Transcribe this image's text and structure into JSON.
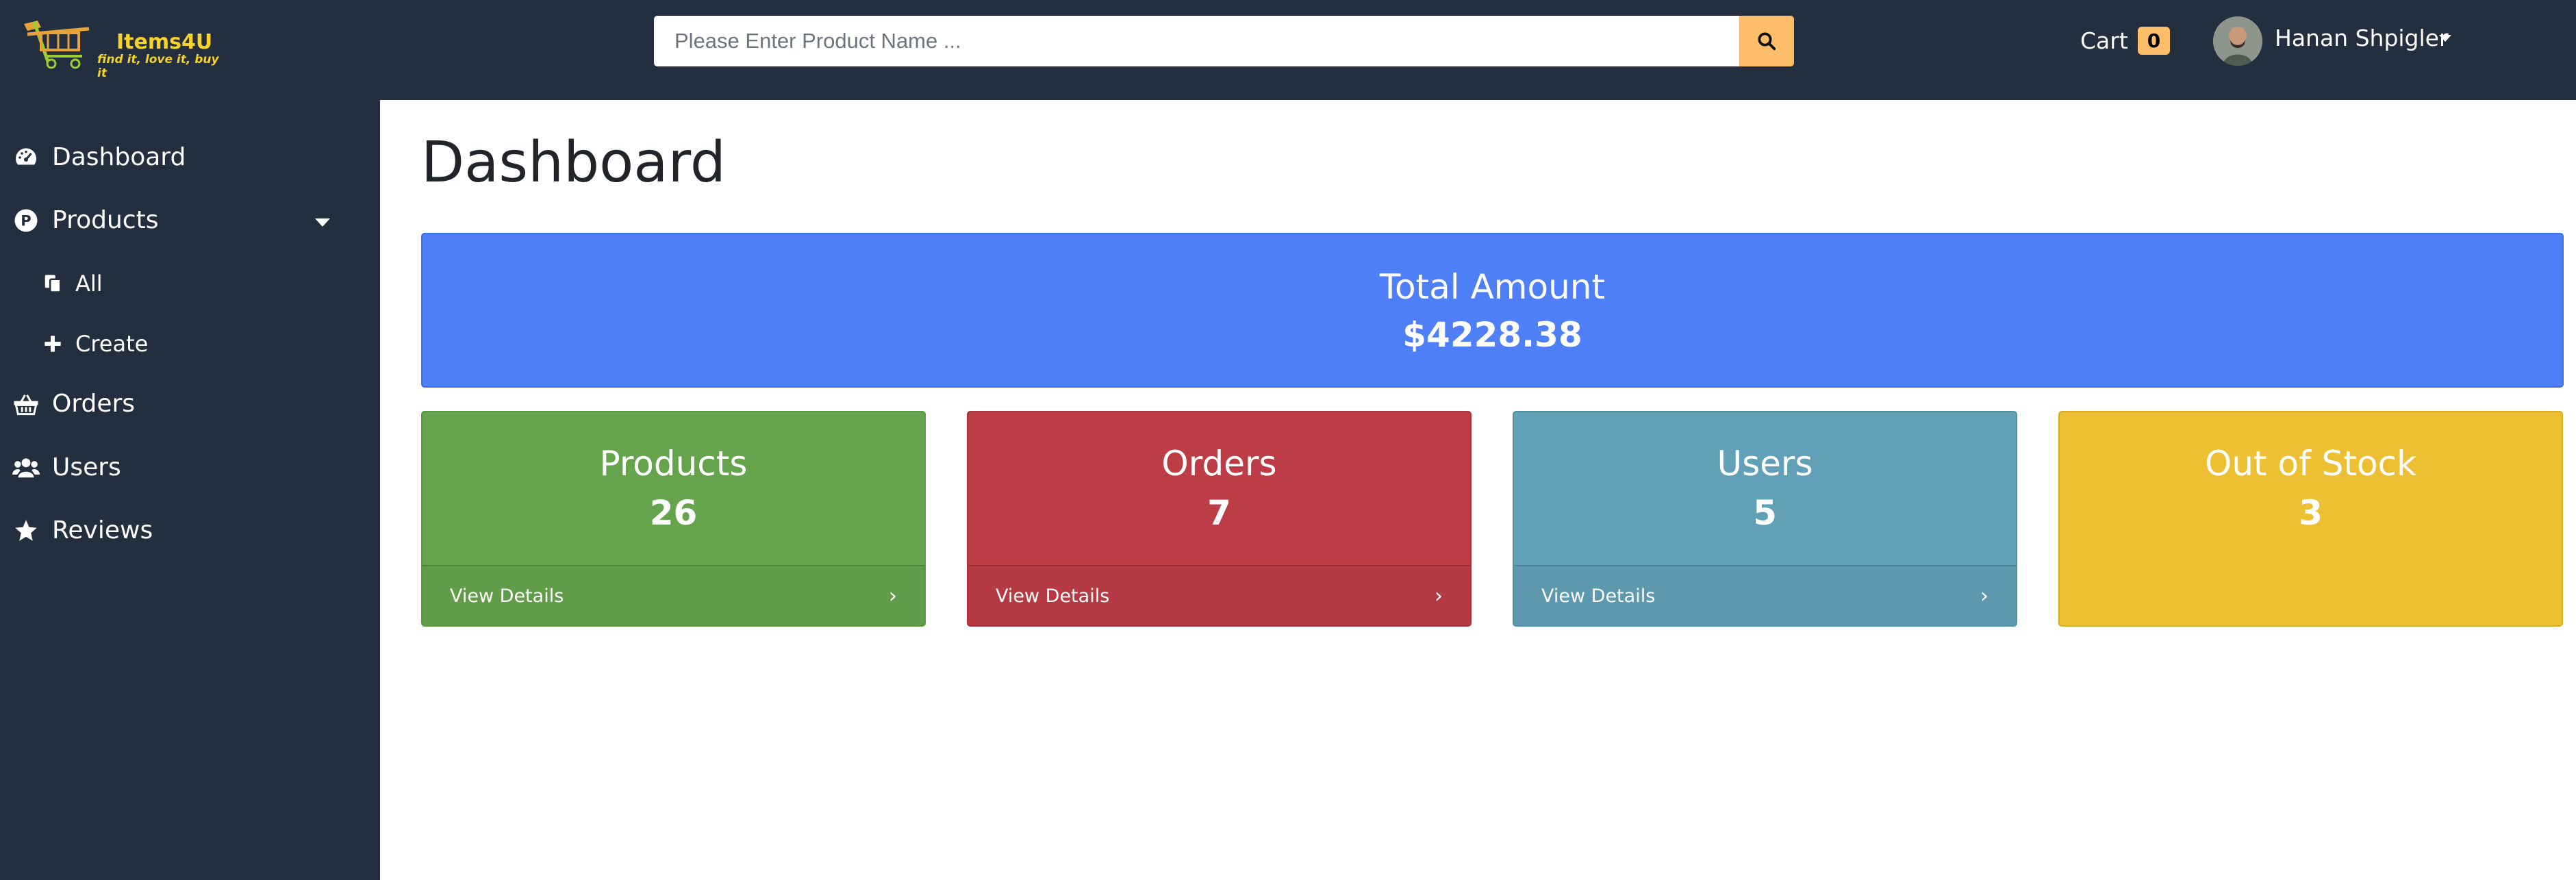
{
  "header": {
    "logo_text": "Items4U",
    "logo_tagline": "find it, love it, buy it",
    "search_placeholder": "Please Enter Product Name ...",
    "cart_label": "Cart",
    "cart_count": "0",
    "user_name": "Hanan Shpigler"
  },
  "sidebar": {
    "items": [
      {
        "label": "Dashboard",
        "icon": "tachometer-icon"
      },
      {
        "label": "Products",
        "icon": "product-p-icon"
      },
      {
        "label": "All",
        "icon": "copy-icon"
      },
      {
        "label": "Create",
        "icon": "plus-icon"
      },
      {
        "label": "Orders",
        "icon": "basket-icon"
      },
      {
        "label": "Users",
        "icon": "users-icon"
      },
      {
        "label": "Reviews",
        "icon": "star-icon"
      }
    ]
  },
  "main": {
    "title": "Dashboard",
    "total": {
      "label": "Total Amount",
      "value": "$4228.38"
    },
    "cards": [
      {
        "label": "Products",
        "value": "26",
        "footer": "View Details",
        "color": "#65a44c"
      },
      {
        "label": "Orders",
        "value": "7",
        "footer": "View Details",
        "color": "#bd3d47"
      },
      {
        "label": "Users",
        "value": "5",
        "footer": "View Details",
        "color": "#61a0b6"
      },
      {
        "label": "Out of Stock",
        "value": "3",
        "color": "#ecc032"
      }
    ]
  },
  "colors": {
    "header_bg": "#232f3e",
    "accent": "#febd69",
    "total_bg": "#4f7ff7"
  }
}
